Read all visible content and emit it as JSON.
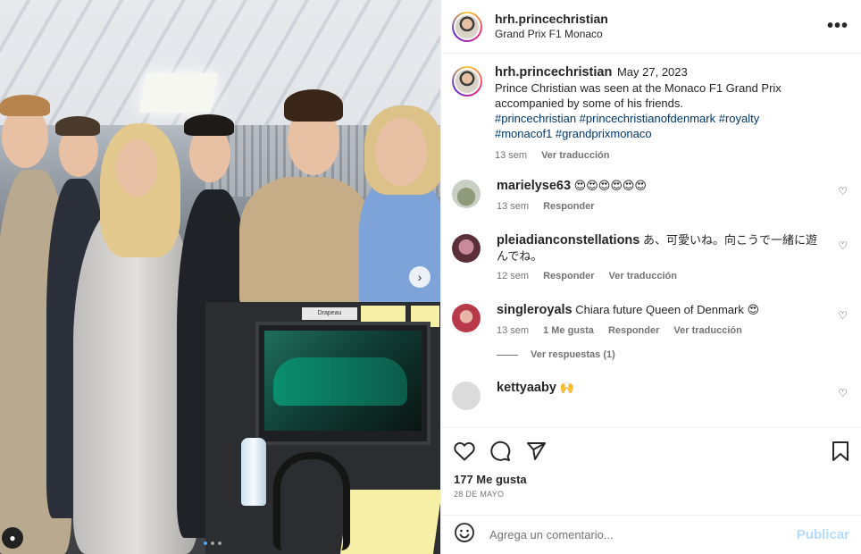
{
  "post": {
    "username": "hrh.princechristian",
    "location": "Grand Prix F1 Monaco",
    "caption": {
      "username": "hrh.princechristian",
      "date": "May 27, 2023",
      "text": "Prince Christian was seen at the Monaco F1 Grand Prix accompanied by some of his friends.",
      "hashtags_line1": "#princechristian #princechristianofdenmark #royalty",
      "hashtags_line2": "#monacof1 #grandprixmonaco",
      "age": "13 sem",
      "translate": "Ver traducción"
    },
    "likes": "177 Me gusta",
    "date": "28 DE MAYO"
  },
  "comments": [
    {
      "username": "marielyse63",
      "text": "😍😍😍😍😍😍",
      "age": "13 sem",
      "reply": "Responder"
    },
    {
      "username": "pleiadianconstellations",
      "text": "あ、可愛いね。向こうで一緒に遊んでね。",
      "age": "12 sem",
      "reply": "Responder",
      "translate": "Ver traducción"
    },
    {
      "username": "singleroyals",
      "text": "Chiara future Queen of Denmark 😍",
      "age": "13 sem",
      "likes": "1 Me gusta",
      "reply": "Responder",
      "translate": "Ver traducción"
    },
    {
      "username": "kettyaaby",
      "text": "🙌"
    }
  ],
  "view_replies": "Ver respuestas (1)",
  "add_comment": {
    "placeholder": "Agrega un comentario...",
    "post_label": "Publicar"
  },
  "photo_text": {
    "monitor_label": "Drapeau"
  },
  "colors": {
    "link": "#00376b",
    "muted": "#737373",
    "post_disabled": "#b3dbff"
  }
}
